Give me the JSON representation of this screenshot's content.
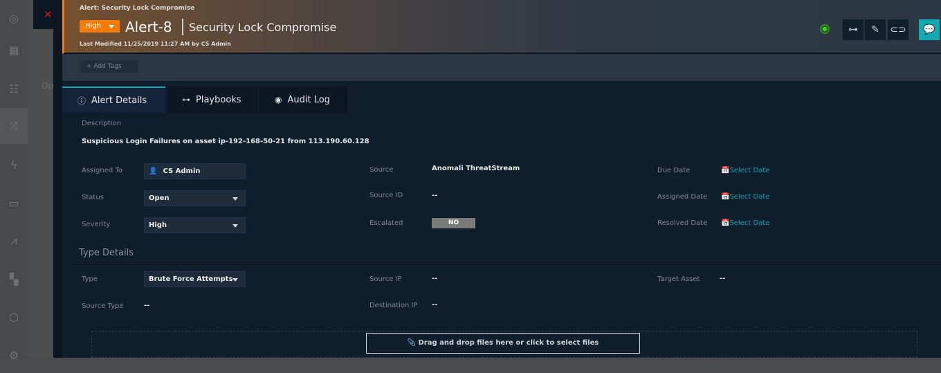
{
  "sidebar": {
    "icons": [
      "dashboard-icon",
      "grid-icon",
      "team-icon",
      "shuffle-icon",
      "bolt-icon",
      "briefcase-icon",
      "chart-icon",
      "widgets-icon",
      "shield-icon",
      "settings-icon"
    ]
  },
  "backdrop": {
    "partial_text": "Op"
  },
  "header": {
    "breadcrumb": "Alert: Security Lock Compromise",
    "severity": "High",
    "alert_id": "Alert-8",
    "title": "Security Lock Compromise",
    "last_modified": "Last Modified 11/25/2019 11:27 AM by CS Admin",
    "colors": {
      "severity": "#f57c00",
      "accent": "#10a9b4",
      "status": "#3bd017"
    }
  },
  "tags": {
    "add_label": "+ Add Tags"
  },
  "tabs": [
    {
      "label": "Alert Details"
    },
    {
      "label": "Playbooks"
    },
    {
      "label": "Audit Log"
    }
  ],
  "details": {
    "description_label": "Description",
    "description": "Suspicious Login Failures on asset ip-192-168-50-21 from 113.190.60.128",
    "assigned_to_label": "Assigned To",
    "assigned_to": "CS Admin",
    "status_label": "Status",
    "status": "Open",
    "severity_label": "Severity",
    "severity": "High",
    "source_label": "Source",
    "source": "Anomali ThreatStream",
    "source_id_label": "Source ID",
    "source_id": "--",
    "escalated_label": "Escalated",
    "escalated": "NO",
    "due_date_label": "Due Date",
    "assigned_date_label": "Assigned Date",
    "resolved_date_label": "Resolved Date",
    "select_date": "Select Date"
  },
  "type_details": {
    "title": "Type Details",
    "type_label": "Type",
    "type": "Brute Force Attempts",
    "source_ip_label": "Source IP",
    "source_ip": "--",
    "target_asset_label": "Target Asset",
    "target_asset": "--",
    "source_type_label": "Source Type",
    "source_type": "--",
    "destination_ip_label": "Destination IP",
    "destination_ip": "--"
  },
  "upload": {
    "label": "Drag and drop files here or click to select files"
  }
}
